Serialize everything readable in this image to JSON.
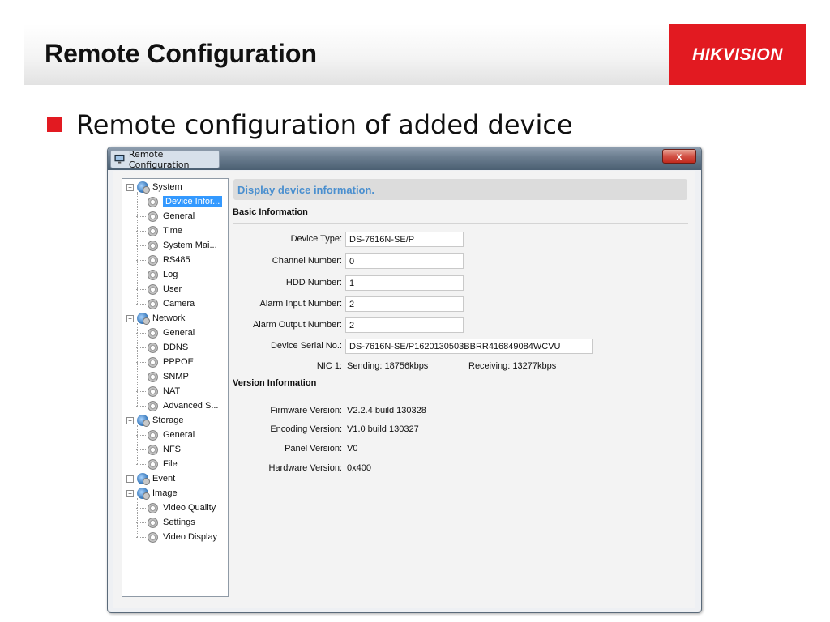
{
  "slide": {
    "title": "Remote Configuration",
    "logo_text": "HIKVISION",
    "bullet": "Remote configuration of added device",
    "accent_color": "#e21a21"
  },
  "window": {
    "title": "Remote Configuration",
    "close_label": "x"
  },
  "tree": [
    {
      "label": "System",
      "level": 0,
      "type": "root",
      "expander": "−"
    },
    {
      "label": "Device Infor...",
      "level": 1,
      "type": "leaf",
      "selected": true
    },
    {
      "label": "General",
      "level": 1,
      "type": "leaf"
    },
    {
      "label": "Time",
      "level": 1,
      "type": "leaf"
    },
    {
      "label": "System Mai...",
      "level": 1,
      "type": "leaf"
    },
    {
      "label": "RS485",
      "level": 1,
      "type": "leaf"
    },
    {
      "label": "Log",
      "level": 1,
      "type": "leaf"
    },
    {
      "label": "User",
      "level": 1,
      "type": "leaf"
    },
    {
      "label": "Camera",
      "level": 1,
      "type": "leaf"
    },
    {
      "label": "Network",
      "level": 0,
      "type": "root",
      "expander": "−"
    },
    {
      "label": "General",
      "level": 1,
      "type": "leaf"
    },
    {
      "label": "DDNS",
      "level": 1,
      "type": "leaf"
    },
    {
      "label": "PPPOE",
      "level": 1,
      "type": "leaf"
    },
    {
      "label": "SNMP",
      "level": 1,
      "type": "leaf"
    },
    {
      "label": "NAT",
      "level": 1,
      "type": "leaf"
    },
    {
      "label": "Advanced S...",
      "level": 1,
      "type": "leaf"
    },
    {
      "label": "Storage",
      "level": 0,
      "type": "root",
      "expander": "−"
    },
    {
      "label": "General",
      "level": 1,
      "type": "leaf"
    },
    {
      "label": "NFS",
      "level": 1,
      "type": "leaf"
    },
    {
      "label": "File",
      "level": 1,
      "type": "leaf"
    },
    {
      "label": "Event",
      "level": 0,
      "type": "root",
      "expander": "+"
    },
    {
      "label": "Image",
      "level": 0,
      "type": "root",
      "expander": "−"
    },
    {
      "label": "Video Quality",
      "level": 1,
      "type": "leaf"
    },
    {
      "label": "Settings",
      "level": 1,
      "type": "leaf"
    },
    {
      "label": "Video Display",
      "level": 1,
      "type": "leaf"
    }
  ],
  "panel": {
    "header": "Display device information.",
    "basic_title": "Basic Information",
    "fields": {
      "device_type_label": "Device Type:",
      "device_type": "DS-7616N-SE/P",
      "channel_number_label": "Channel Number:",
      "channel_number": "0",
      "hdd_number_label": "HDD Number:",
      "hdd_number": "1",
      "alarm_input_label": "Alarm Input Number:",
      "alarm_input": "2",
      "alarm_output_label": "Alarm Output Number:",
      "alarm_output": "2",
      "serial_label": "Device Serial No.:",
      "serial": "DS-7616N-SE/P1620130503BBRR416849084WCVU",
      "nic_label": "NIC 1:",
      "nic_sending": "Sending: 18756kbps",
      "nic_receiving": "Receiving: 13277kbps"
    },
    "version_title": "Version Information",
    "versions": {
      "firmware_label": "Firmware Version:",
      "firmware": "V2.2.4 build 130328",
      "encoding_label": "Encoding Version:",
      "encoding": "V1.0 build 130327",
      "panel_label": "Panel Version:",
      "panel": "V0",
      "hardware_label": "Hardware Version:",
      "hardware": "0x400"
    }
  }
}
